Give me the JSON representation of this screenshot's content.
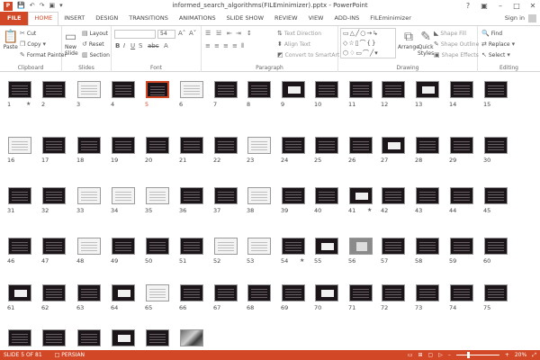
{
  "window": {
    "title": "informed_search_algorithms(FILEminimizer).pptx - PowerPoint",
    "qat_icons": [
      "powerpoint-logo",
      "save-icon",
      "undo-icon",
      "redo-icon",
      "start-slideshow-icon"
    ],
    "controls": {
      "help": "?",
      "restore": "▣",
      "minimize": "–",
      "maximize": "□",
      "close": "✕"
    }
  },
  "tabs": [
    {
      "label": "FILE"
    },
    {
      "label": "HOME"
    },
    {
      "label": "INSERT"
    },
    {
      "label": "DESIGN"
    },
    {
      "label": "TRANSITIONS"
    },
    {
      "label": "ANIMATIONS"
    },
    {
      "label": "SLIDE SHOW"
    },
    {
      "label": "REVIEW"
    },
    {
      "label": "VIEW"
    },
    {
      "label": "ADD-INS"
    },
    {
      "label": "FILEminimizer"
    }
  ],
  "active_tab": "HOME",
  "account": {
    "signin": "Sign in"
  },
  "ribbon": {
    "clipboard": {
      "label": "Clipboard",
      "paste": "Paste",
      "cut": "Cut",
      "copy": "Copy",
      "format_painter": "Format Painter"
    },
    "slides": {
      "label": "Slides",
      "new_slide": "New",
      "new_slide_2": "Slide",
      "layout": "Layout",
      "reset": "Reset",
      "section": "Section"
    },
    "font": {
      "label": "Font",
      "font_size": "54"
    },
    "paragraph": {
      "label": "Paragraph",
      "text_direction": "Text Direction",
      "align_text": "Align Text",
      "smartart": "Convert to SmartArt"
    },
    "drawing": {
      "label": "Drawing",
      "arrange": "Arrange",
      "quick_styles": "Quick",
      "quick_styles_2": "Styles",
      "shape_fill": "Shape Fill",
      "shape_outline": "Shape Outline",
      "shape_effects": "Shape Effects"
    },
    "editing": {
      "label": "Editing",
      "find": "Find",
      "replace": "Replace",
      "select": "Select"
    }
  },
  "slides": {
    "count": 81,
    "selected": 5,
    "starred": [
      1,
      41,
      54
    ],
    "white_slides": [
      3,
      6,
      16,
      23,
      33,
      34,
      35,
      38,
      48,
      52,
      53,
      65
    ],
    "box_slides": [
      9,
      13,
      27,
      41,
      55,
      61,
      64,
      70,
      79
    ],
    "gray_slides": [
      56
    ],
    "photo_slides": [
      81
    ]
  },
  "status": {
    "slide_info": "SLIDE 5 OF 81",
    "language": "PERSIAN",
    "zoom": "20%"
  }
}
